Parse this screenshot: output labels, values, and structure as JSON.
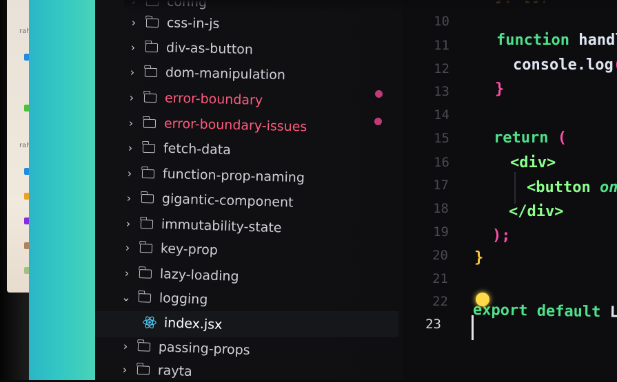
{
  "background_window": {
    "label_1": "rahu",
    "label_2": "rahu"
  },
  "explorer": {
    "items": [
      {
        "label": "config",
        "expanded": false,
        "modified": false
      },
      {
        "label": "css-in-js",
        "expanded": false,
        "modified": false
      },
      {
        "label": "div-as-button",
        "expanded": false,
        "modified": false
      },
      {
        "label": "dom-manipulation",
        "expanded": false,
        "modified": false
      },
      {
        "label": "error-boundary",
        "expanded": false,
        "modified": true
      },
      {
        "label": "error-boundary-issues",
        "expanded": false,
        "modified": true
      },
      {
        "label": "fetch-data",
        "expanded": false,
        "modified": false
      },
      {
        "label": "function-prop-naming",
        "expanded": false,
        "modified": false
      },
      {
        "label": "gigantic-component",
        "expanded": false,
        "modified": false
      },
      {
        "label": "immutability-state",
        "expanded": false,
        "modified": false
      },
      {
        "label": "key-prop",
        "expanded": false,
        "modified": false
      },
      {
        "label": "lazy-loading",
        "expanded": false,
        "modified": false
      },
      {
        "label": "logging",
        "expanded": true,
        "modified": false
      },
      {
        "label": "index.jsx",
        "file": true,
        "selected": true
      },
      {
        "label": "passing-props",
        "expanded": false,
        "modified": false
      },
      {
        "label": "rayta",
        "expanded": false,
        "modified": false
      }
    ]
  },
  "editor": {
    "line_numbers": [
      "10",
      "11",
      "12",
      "13",
      "14",
      "15",
      "16",
      "17",
      "18",
      "19",
      "20",
      "21",
      "22",
      "23"
    ],
    "active_line": "23",
    "code": {
      "l9_tail": "}, [])",
      "l11_kw": "function",
      "l11_name": "handl",
      "l12_text": "console.log",
      "l12_paren": "(",
      "l13_brace": "}",
      "l15_kw": "return",
      "l15_paren": "(",
      "l16_tag": "<div>",
      "l17_tag": "<button",
      "l17_attr": "on",
      "l18_tag": "</div>",
      "l19_close": ");",
      "l20_brace": "}",
      "l22_export": "export default",
      "l22_name": "L"
    }
  },
  "colors": {
    "modified": "#ff5a7c",
    "modified_dot": "#c03a78",
    "keyword": "#4fe08a",
    "paren": "#ff4fa8",
    "brace": "#ffc73a"
  }
}
